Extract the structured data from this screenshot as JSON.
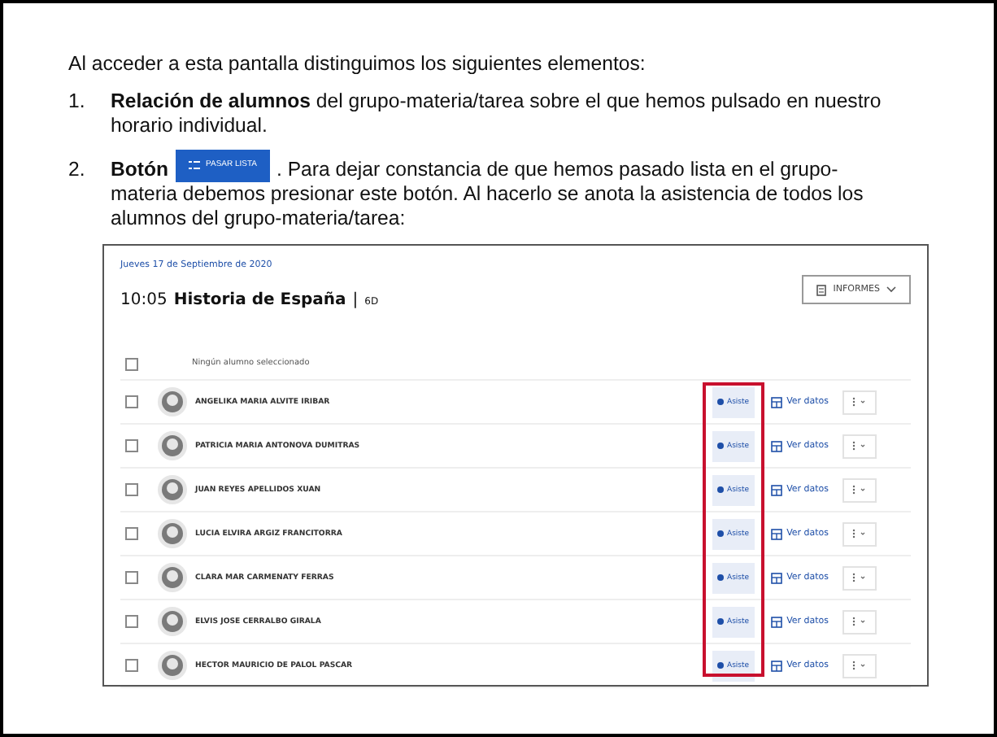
{
  "intro": "Al acceder a esta pantalla distinguimos los siguientes elementos:",
  "items": [
    {
      "kind": "text",
      "number": "1.",
      "text": "**Relación de alumnos** del grupo-materia/tarea sobre el que hemos pulsado en nuestro horario individual."
    },
    {
      "kind": "button",
      "number": "2.",
      "lead": "Botón",
      "button": "PASAR LISTA",
      "text": ". Para dejar constancia de que hemos pasado lista en el grupo-",
      "continuation": "materia debemos presionar este botón. Al hacerlo se anota la asistencia de todos los alumnos del grupo-materia/tarea:"
    }
  ],
  "app": {
    "date": "Jueves 17 de Septiembre de 2020",
    "time": "10:05",
    "subject": "Historia de España",
    "separator": "|",
    "group": "6D",
    "reports_button": "INFORMES",
    "select_all": {
      "label": "Ningún alumno seleccionado",
      "checked": false
    },
    "status_column_highlighted": true,
    "students": [
      {
        "name": "ANGELIKA MARIA ALVITE IRIBAR",
        "checked": false,
        "status": "Asiste",
        "link": "Ver datos"
      },
      {
        "name": "PATRICIA MARIA ANTONOVA DUMITRAS",
        "checked": false,
        "status": "Asiste",
        "link": "Ver datos"
      },
      {
        "name": "JUAN REYES APELLIDOS XUAN",
        "checked": false,
        "status": "Asiste",
        "link": "Ver datos"
      },
      {
        "name": "LUCIA ELVIRA ARGIZ FRANCITORRA",
        "checked": false,
        "status": "Asiste",
        "link": "Ver datos"
      },
      {
        "name": "CLARA MAR CARMENATY FERRAS",
        "checked": false,
        "status": "Asiste",
        "link": "Ver datos"
      },
      {
        "name": "ELVIS JOSE CERRALBO GIRALA",
        "checked": false,
        "status": "Asiste",
        "link": "Ver datos"
      },
      {
        "name": "HECTOR MAURICIO DE PALOL PASCAR",
        "checked": false,
        "status": "Asiste",
        "link": "Ver datos"
      }
    ]
  }
}
